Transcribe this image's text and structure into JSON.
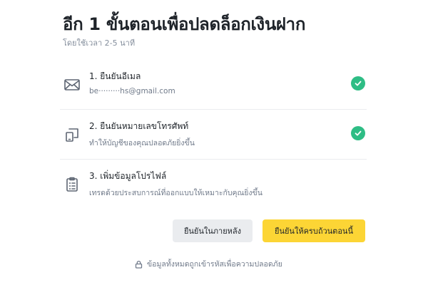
{
  "header": {
    "title": "อีก 1 ขั้นตอนเพื่อปลดล็อกเงินฝาก",
    "subtitle": "โดยใช้เวลา 2-5 นาที"
  },
  "steps": [
    {
      "title": "1. ยืนยันอีเมล",
      "description": "be·········hs@gmail.com",
      "icon": "mail-icon",
      "completed": true
    },
    {
      "title": "2. ยืนยันหมายเลขโทรศัพท์",
      "description": "ทำให้บัญชีของคุณปลอดภัยยิ่งขึ้น",
      "icon": "phone-icon",
      "completed": true
    },
    {
      "title": "3. เพิ่มข้อมูลโปรไฟล์",
      "description": "เทรดด้วยประสบการณ์ที่ออกแบบให้เหมาะกับคุณยิ่งขึ้น",
      "icon": "clipboard-icon",
      "completed": false
    }
  ],
  "actions": {
    "later_label": "ยืนยันในภายหลัง",
    "complete_label": "ยืนยันให้ครบถ้วนตอนนี้"
  },
  "footer": {
    "note": "ข้อมูลทั้งหมดถูกเข้ารหัสเพื่อความปลอดภัย",
    "icon": "lock-icon"
  },
  "colors": {
    "primary": "#fcd535",
    "success": "#2ebd85",
    "secondary_button": "#eaecef",
    "text": "#1e2329",
    "muted_text": "#707a8a"
  }
}
